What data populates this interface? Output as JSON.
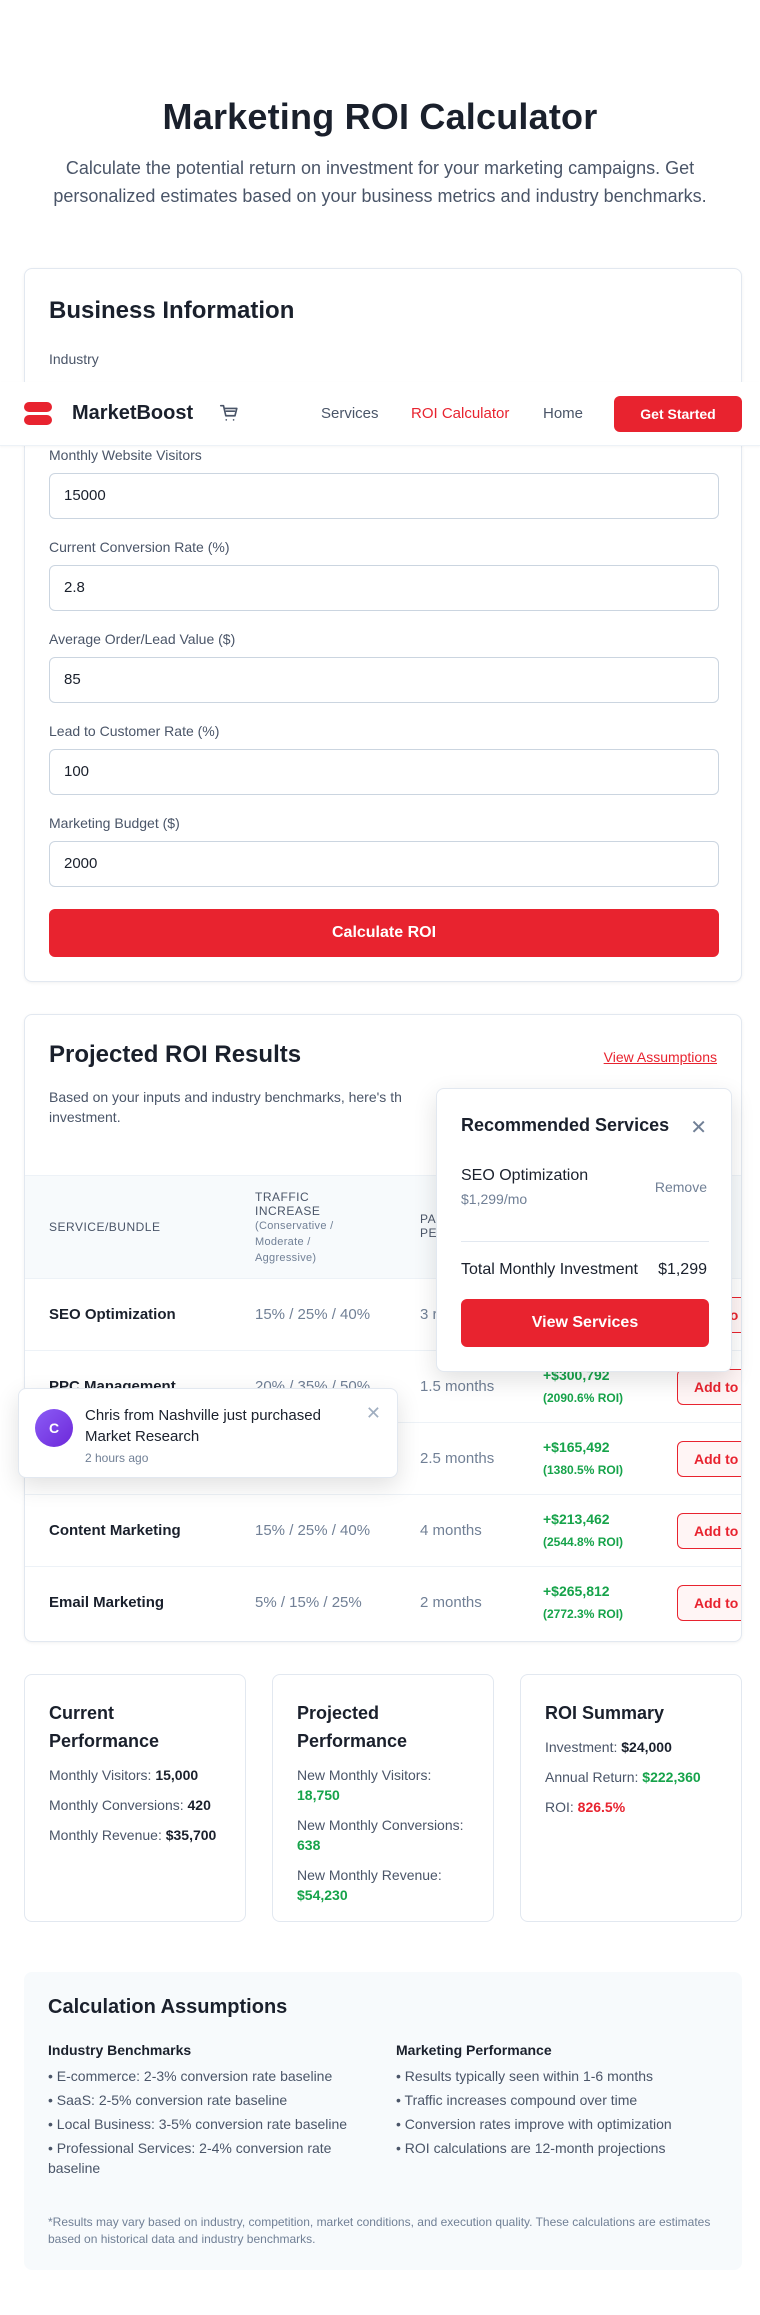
{
  "hero": {
    "title": "Marketing ROI Calculator",
    "subtitle": "Calculate the potential return on investment for your marketing campaigns. Get personalized estimates based on your business metrics and industry benchmarks."
  },
  "business_form": {
    "title": "Business Information",
    "industry_label": "Industry",
    "visitors_label": "Monthly Website Visitors",
    "visitors_value": "15000",
    "conversion_label": "Current Conversion Rate (%)",
    "conversion_value": "2.8",
    "order_value_label": "Average Order/Lead Value ($)",
    "order_value_value": "85",
    "lead_rate_label": "Lead to Customer Rate (%)",
    "lead_rate_value": "100",
    "budget_label": "Marketing Budget ($)",
    "budget_value": "2000",
    "submit_label": "Calculate ROI"
  },
  "navbar": {
    "brand": "MarketBoost",
    "links": [
      "Services",
      "ROI Calculator",
      "Home"
    ],
    "active": "ROI Calculator",
    "cta": "Get Started"
  },
  "results": {
    "title": "Projected ROI Results",
    "view_assumptions": "View Assumptions",
    "intro": "Based on your inputs and industry benchmarks, here's th investment.",
    "columns": {
      "service": "SERVICE/BUNDLE",
      "traffic": "TRAFFIC INCREASE",
      "traffic_sub": "(Conservative / Moderate / Aggressive)",
      "payback": "PA PE"
    },
    "add_label": "Add to",
    "rows": [
      {
        "service": "SEO Optimization",
        "traffic": "15% / 25% / 40%",
        "payback": "3 r",
        "roi": "",
        "roi_pct": ""
      },
      {
        "service": "PPC Management",
        "traffic": "20% / 35% / 50%",
        "payback": "1.5 months",
        "roi": "+$300,792",
        "roi_pct": "(2090.6% ROI)"
      },
      {
        "service": "",
        "traffic": "",
        "payback": "2.5 months",
        "roi": "+$165,492",
        "roi_pct": "(1380.5% ROI)"
      },
      {
        "service": "Content Marketing",
        "traffic": "15% / 25% / 40%",
        "payback": "4 months",
        "roi": "+$213,462",
        "roi_pct": "(2544.8% ROI)"
      },
      {
        "service": "Email Marketing",
        "traffic": "5% / 15% / 25%",
        "payback": "2 months",
        "roi": "+$265,812",
        "roi_pct": "(2772.3% ROI)"
      }
    ]
  },
  "recommended": {
    "title": "Recommended Services",
    "item_name": "SEO Optimization",
    "item_price": "$1,299/mo",
    "remove_label": "Remove",
    "total_label": "Total Monthly Investment",
    "total_value": "$1,299",
    "button": "View Services"
  },
  "toast": {
    "avatar": "C",
    "message": "Chris from Nashville just purchased Market Research",
    "time": "2 hours ago"
  },
  "current": {
    "title": "Current Performance",
    "visitors_label": "Monthly Visitors:",
    "visitors_value": "15,000",
    "conversions_label": "Monthly Conversions:",
    "conversions_value": "420",
    "revenue_label": "Monthly Revenue:",
    "revenue_value": "$35,700"
  },
  "projected": {
    "title": "Projected Performance",
    "visitors_label": "New Monthly Visitors:",
    "visitors_value": "18,750",
    "conversions_label": "New Monthly Conversions:",
    "conversions_value": "638",
    "revenue_label": "New Monthly Revenue:",
    "revenue_value": "$54,230"
  },
  "summary": {
    "title": "ROI Summary",
    "investment_label": "Investment:",
    "investment_value": "$24,000",
    "annual_label": "Annual Return:",
    "annual_value": "$222,360",
    "roi_label": "ROI:",
    "roi_value": "826.5%"
  },
  "assumptions": {
    "title": "Calculation Assumptions",
    "left_title": "Industry Benchmarks",
    "left_items": [
      "• E-commerce: 2-3% conversion rate baseline",
      "• SaaS: 2-5% conversion rate baseline",
      "• Local Business: 3-5% conversion rate baseline",
      "• Professional Services: 2-4% conversion rate baseline"
    ],
    "right_title": "Marketing Performance",
    "right_items": [
      "• Results typically seen within 1-6 months",
      "• Traffic increases compound over time",
      "• Conversion rates improve with optimization",
      "• ROI calculations are 12-month projections"
    ],
    "note": "*Results may vary based on industry, competition, market conditions, and execution quality. These calculations are estimates based on historical data and industry benchmarks."
  },
  "colors": {
    "accent": "#e8232f",
    "positive": "#16a34a",
    "text": "#1a202c",
    "muted": "#4a5568"
  }
}
